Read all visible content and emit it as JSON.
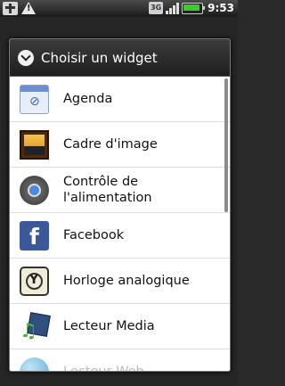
{
  "status_bar": {
    "time": "9:53",
    "network_badge": "3G",
    "icons": [
      "usb-icon",
      "warning-icon",
      "3g-icon",
      "signal-icon",
      "battery-icon"
    ]
  },
  "dialog": {
    "title": "Choisir un widget",
    "title_icon": "widget-chevron-icon",
    "items": [
      {
        "label": "Agenda",
        "icon": "calendar-icon"
      },
      {
        "label": "Cadre d'image",
        "icon": "picture-frame-icon"
      },
      {
        "label": "Contrôle de\nl'alimentation",
        "icon": "power-control-icon"
      },
      {
        "label": "Facebook",
        "icon": "facebook-icon"
      },
      {
        "label": "Horloge analogique",
        "icon": "analog-clock-icon"
      },
      {
        "label": "Lecteur Media",
        "icon": "media-player-icon"
      },
      {
        "label": "Lecteur Web",
        "icon": "globe-icon"
      }
    ]
  },
  "colors": {
    "title_bar": "#1f1f1f",
    "list_bg": "#ffffff",
    "battery": "#3fcb2f",
    "facebook": "#3b5998"
  }
}
